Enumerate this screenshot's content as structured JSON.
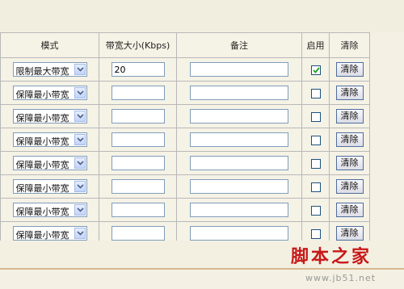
{
  "table": {
    "headers": {
      "mode": "模式",
      "bandwidth": "带宽大小(Kbps)",
      "note": "备注",
      "enable": "启用",
      "clear": "清除"
    },
    "rows": [
      {
        "mode": "限制最大带宽",
        "bandwidth": "20",
        "note": "",
        "enabled": true,
        "clear_label": "清除"
      },
      {
        "mode": "保障最小带宽",
        "bandwidth": "",
        "note": "",
        "enabled": false,
        "clear_label": "清除"
      },
      {
        "mode": "保障最小带宽",
        "bandwidth": "",
        "note": "",
        "enabled": false,
        "clear_label": "清除"
      },
      {
        "mode": "保障最小带宽",
        "bandwidth": "",
        "note": "",
        "enabled": false,
        "clear_label": "清除"
      },
      {
        "mode": "保障最小带宽",
        "bandwidth": "",
        "note": "",
        "enabled": false,
        "clear_label": "清除"
      },
      {
        "mode": "保障最小带宽",
        "bandwidth": "",
        "note": "",
        "enabled": false,
        "clear_label": "清除"
      },
      {
        "mode": "保障最小带宽",
        "bandwidth": "",
        "note": "",
        "enabled": false,
        "clear_label": "清除"
      },
      {
        "mode": "保障最小带宽",
        "bandwidth": "",
        "note": "",
        "enabled": false,
        "clear_label": "清除"
      }
    ]
  },
  "watermark": {
    "main": "脚本之家",
    "sub": "www.jb51.net"
  },
  "colors": {
    "page_bg": "#f4f1e4",
    "border": "#b8b8b8",
    "input_border": "#7f9db9",
    "checkmark": "#21a121",
    "watermark_red": "#c81818"
  }
}
